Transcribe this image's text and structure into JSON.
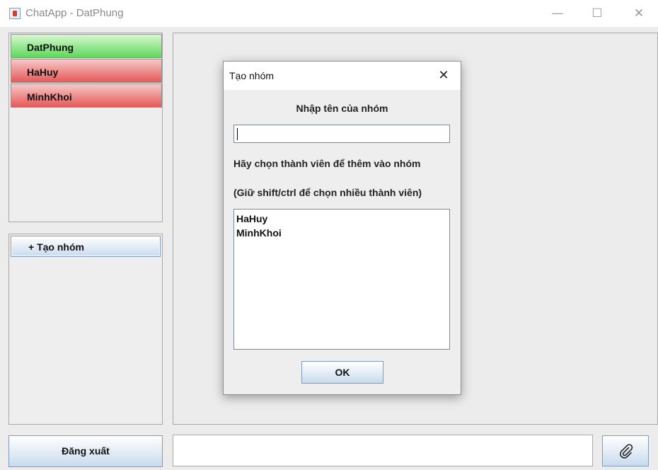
{
  "window": {
    "title": "ChatApp - DatPhung",
    "minimize_glyph": "—",
    "maximize_glyph": "☐",
    "close_glyph": "✕"
  },
  "users": [
    {
      "name": "DatPhung",
      "status_color": "#5ed85a"
    },
    {
      "name": "HaHuy",
      "status_color": "#e65858"
    },
    {
      "name": "MinhKhoi",
      "status_color": "#e65858"
    }
  ],
  "groups": {
    "create_label": "+ Tạo nhóm"
  },
  "footer": {
    "logout_label": "Đăng xuất",
    "message_value": "",
    "attach_icon": "paperclip-icon"
  },
  "dialog": {
    "title": "Tạo nhóm",
    "close_glyph": "✕",
    "name_label": "Nhập tên của nhóm",
    "name_value": "",
    "choose_label": "Hãy chọn thành viên để thêm vào nhóm",
    "hint_label": "(Giữ shift/ctrl để chọn nhiều thành viên)",
    "members": [
      "HaHuy",
      "MinhKhoi"
    ],
    "ok_label": "OK"
  },
  "colors": {
    "online": "#5ed85a",
    "offline": "#e65858",
    "button_gradient_end": "#c9dbee"
  }
}
